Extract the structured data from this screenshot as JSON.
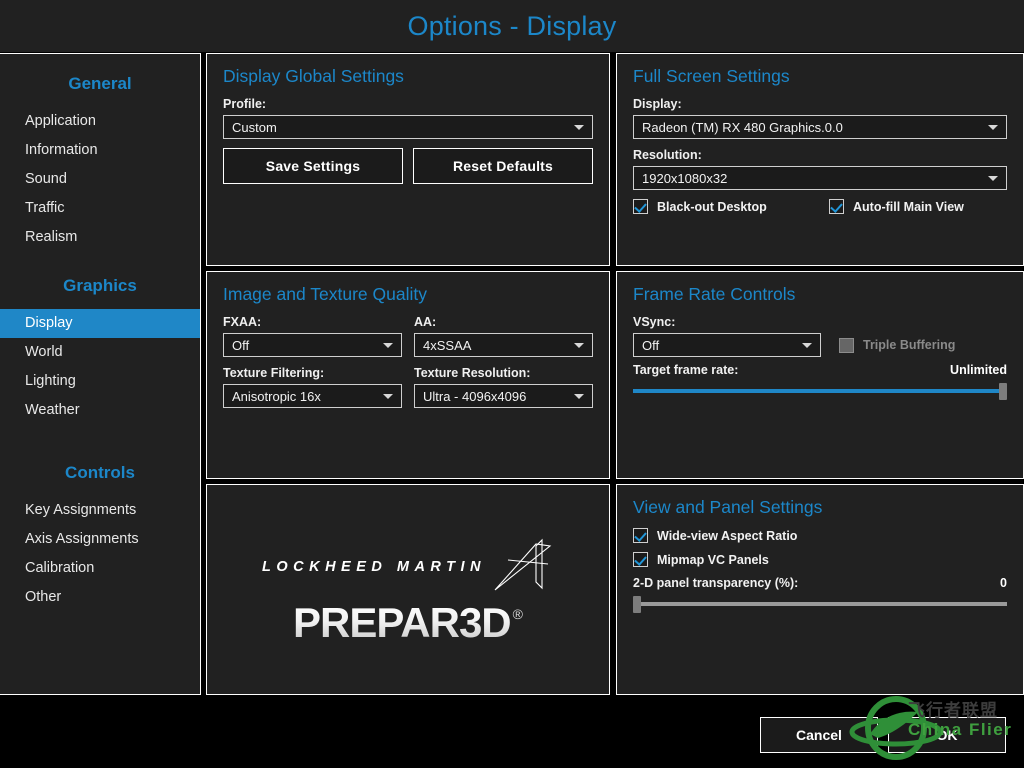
{
  "window": {
    "title": "Options - Display",
    "accent_color": "#1c87c9",
    "panel_bg": "#212121",
    "selected_color": "#1f87c7"
  },
  "sidebar": {
    "groups": [
      {
        "title": "General",
        "items": [
          {
            "label": "Application",
            "selected": false
          },
          {
            "label": "Information",
            "selected": false
          },
          {
            "label": "Sound",
            "selected": false
          },
          {
            "label": "Traffic",
            "selected": false
          },
          {
            "label": "Realism",
            "selected": false
          }
        ]
      },
      {
        "title": "Graphics",
        "items": [
          {
            "label": "Display",
            "selected": true
          },
          {
            "label": "World",
            "selected": false
          },
          {
            "label": "Lighting",
            "selected": false
          },
          {
            "label": "Weather",
            "selected": false
          }
        ]
      },
      {
        "title": "Controls",
        "items": [
          {
            "label": "Key Assignments",
            "selected": false
          },
          {
            "label": "Axis Assignments",
            "selected": false
          },
          {
            "label": "Calibration",
            "selected": false
          },
          {
            "label": "Other",
            "selected": false
          }
        ]
      }
    ]
  },
  "display_global_settings": {
    "title": "Display Global Settings",
    "profile_label": "Profile:",
    "profile_value": "Custom",
    "save_button": "Save Settings",
    "reset_button": "Reset Defaults"
  },
  "full_screen_settings": {
    "title": "Full Screen Settings",
    "display_label": "Display:",
    "display_value": "Radeon (TM) RX 480 Graphics.0.0",
    "resolution_label": "Resolution:",
    "resolution_value": "1920x1080x32",
    "blackout_desktop": {
      "label": "Black-out Desktop",
      "checked": true
    },
    "autofill_main_view": {
      "label": "Auto-fill Main View",
      "checked": true
    }
  },
  "image_texture_quality": {
    "title": "Image and Texture Quality",
    "fxaa_label": "FXAA:",
    "fxaa_value": "Off",
    "aa_label": "AA:",
    "aa_value": "4xSSAA",
    "texture_filtering_label": "Texture Filtering:",
    "texture_filtering_value": "Anisotropic 16x",
    "texture_resolution_label": "Texture Resolution:",
    "texture_resolution_value": "Ultra - 4096x4096"
  },
  "frame_rate_controls": {
    "title": "Frame Rate Controls",
    "vsync_label": "VSync:",
    "vsync_value": "Off",
    "triple_buffering": {
      "label": "Triple Buffering",
      "checked": false,
      "disabled": true
    },
    "target_frame_rate_label": "Target frame rate:",
    "target_frame_rate_value": "Unlimited",
    "target_frame_rate_percent": 100
  },
  "view_and_panel_settings": {
    "title": "View and Panel Settings",
    "wide_view_aspect_ratio": {
      "label": "Wide-view Aspect Ratio",
      "checked": true
    },
    "mipmap_vc_panels": {
      "label": "Mipmap VC Panels",
      "checked": true
    },
    "panel_transparency_label": "2-D panel transparency (%):",
    "panel_transparency_value": "0",
    "panel_transparency_percent": 0
  },
  "branding": {
    "company": "LOCKHEED MARTIN",
    "product": "PREPAR3D",
    "registered_mark": "®"
  },
  "footer": {
    "cancel_button": "Cancel",
    "ok_button": "OK"
  },
  "watermark": {
    "chinese_text": "飞行者联盟",
    "english_text": "China Flier",
    "color": "#3fa03f"
  }
}
